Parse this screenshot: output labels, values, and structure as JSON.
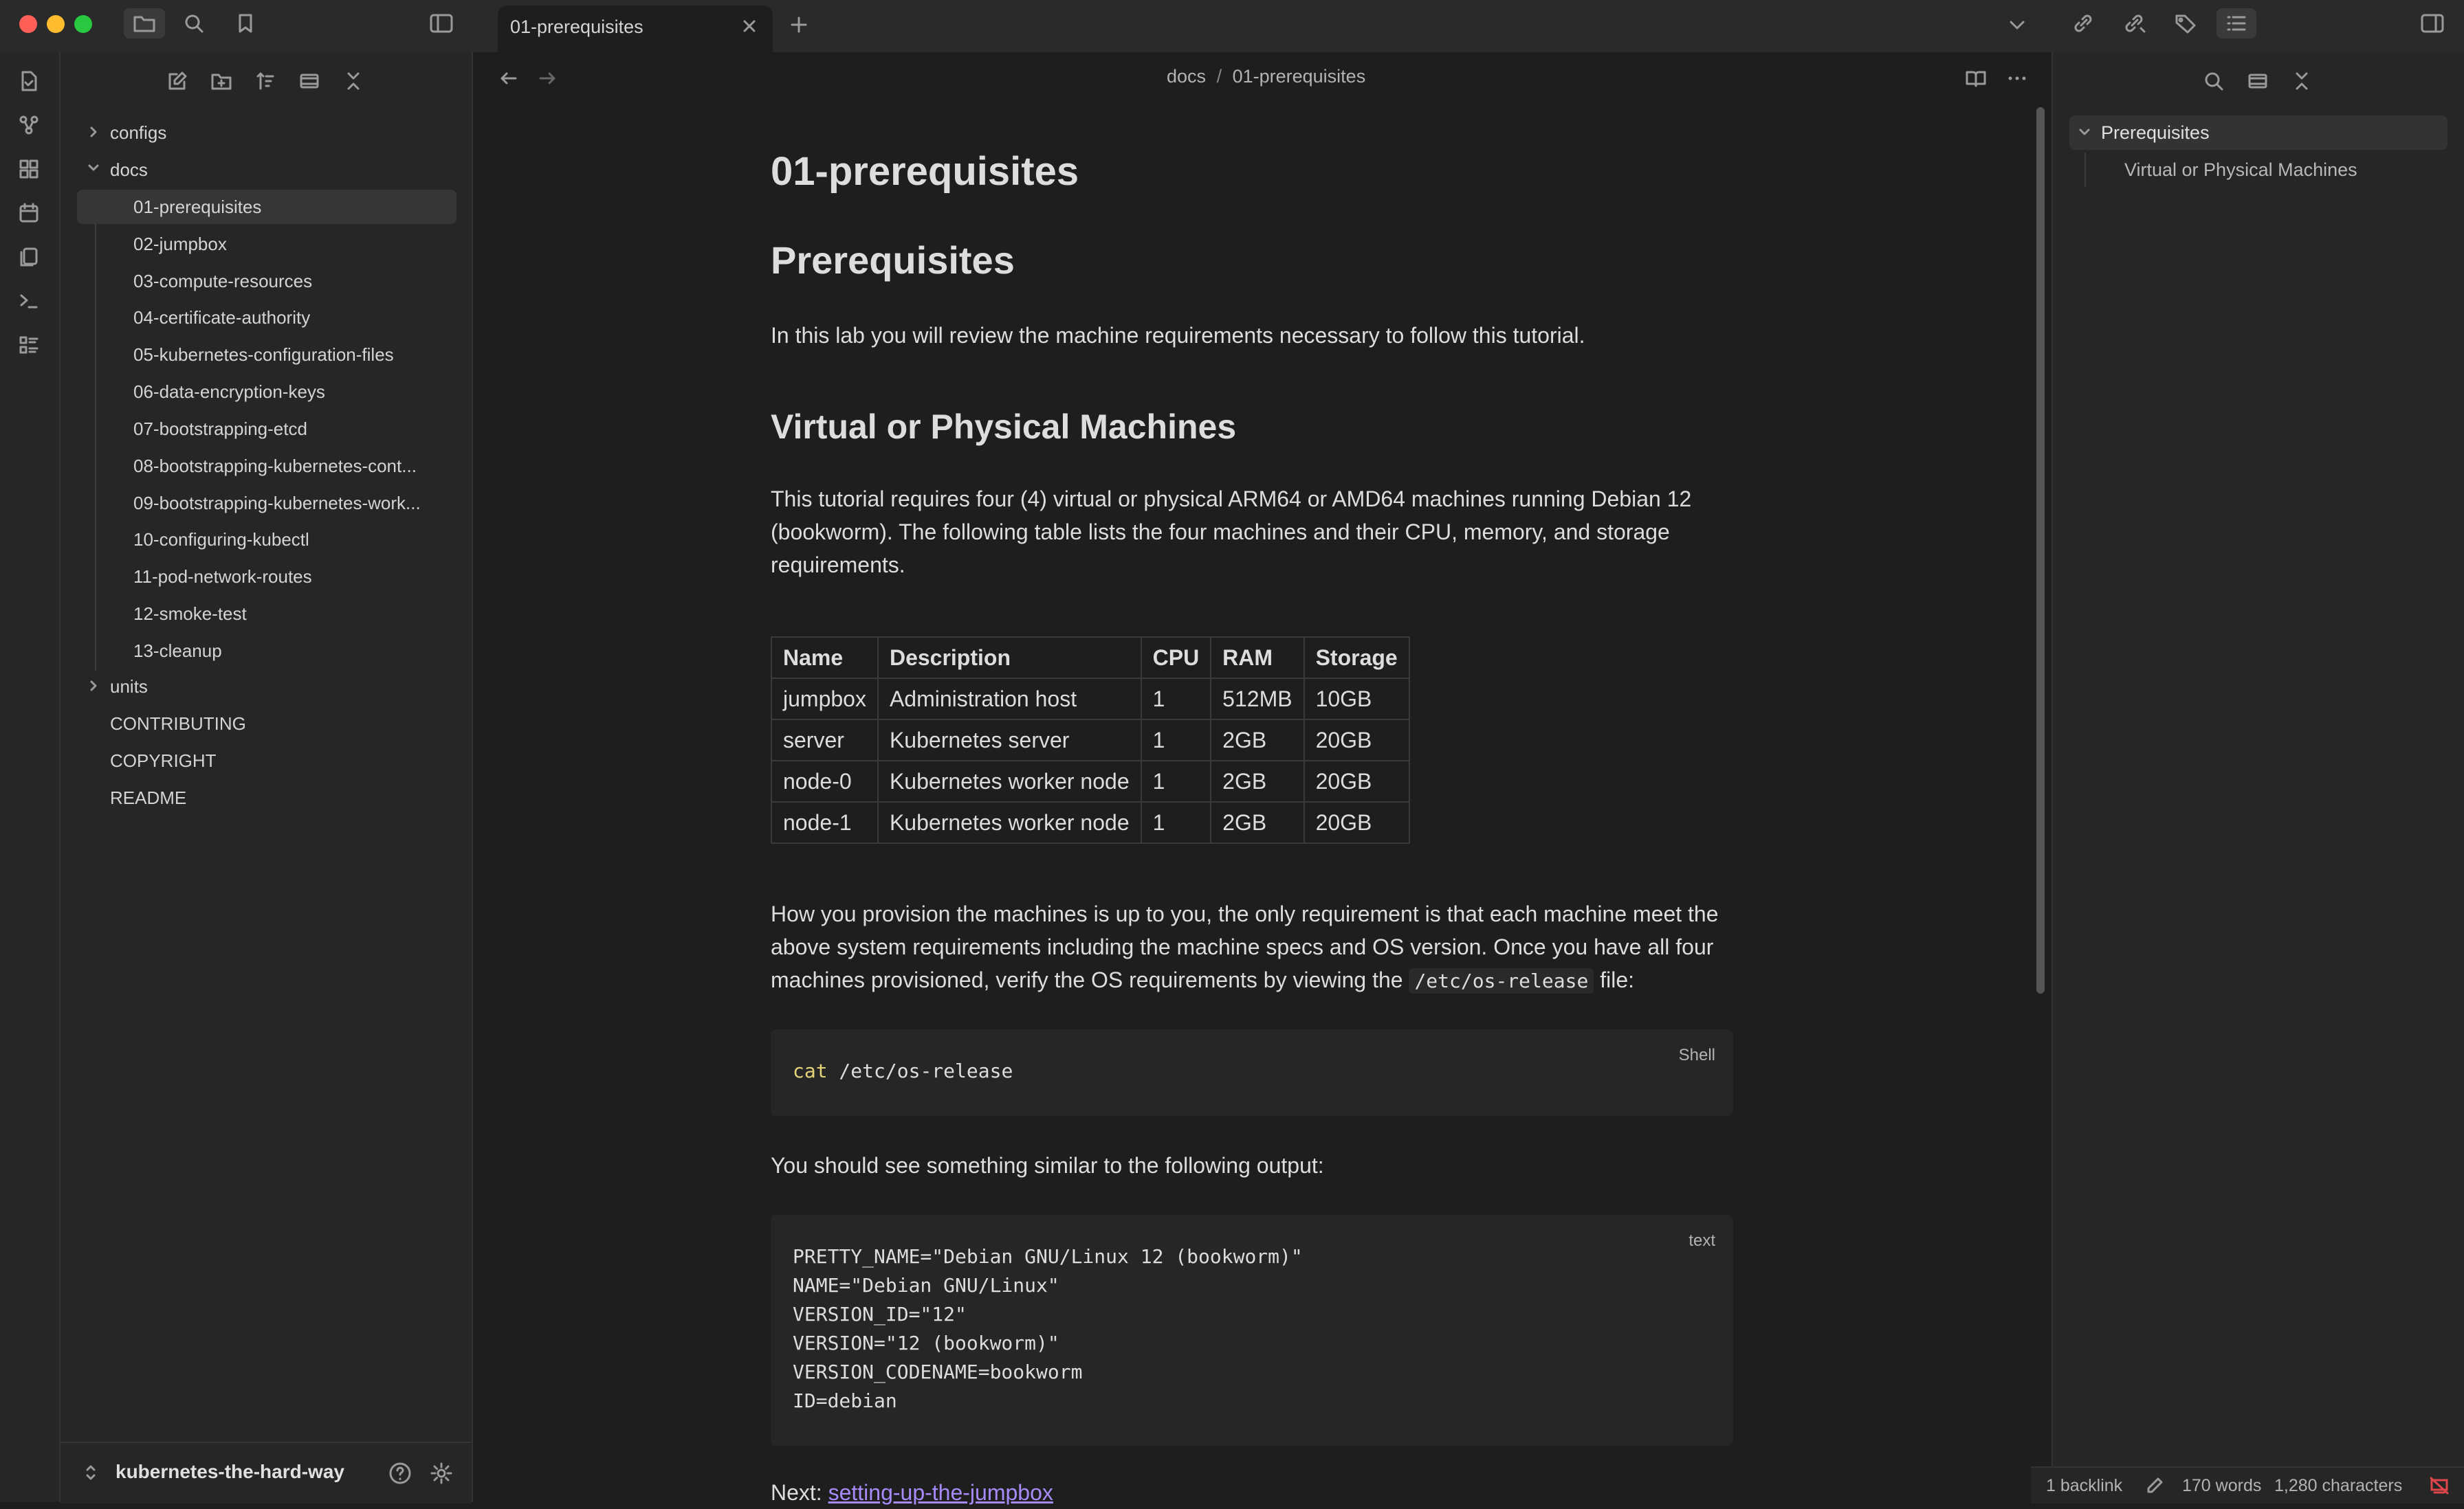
{
  "app": {
    "tab_title": "01-prerequisites",
    "vault_name": "kubernetes-the-hard-way"
  },
  "breadcrumb": {
    "parent": "docs",
    "separator": "/",
    "current": "01-prerequisites"
  },
  "explorer": {
    "root_folders_top": [
      {
        "label": "configs",
        "expanded": false
      },
      {
        "label": "docs",
        "expanded": true
      }
    ],
    "docs_items": [
      "01-prerequisites",
      "02-jumpbox",
      "03-compute-resources",
      "04-certificate-authority",
      "05-kubernetes-configuration-files",
      "06-data-encryption-keys",
      "07-bootstrapping-etcd",
      "08-bootstrapping-kubernetes-cont...",
      "09-bootstrapping-kubernetes-work...",
      "10-configuring-kubectl",
      "11-pod-network-routes",
      "12-smoke-test",
      "13-cleanup"
    ],
    "folder_units": "units",
    "root_files": [
      "CONTRIBUTING",
      "COPYRIGHT",
      "README"
    ]
  },
  "document": {
    "inline_title": "01-prerequisites",
    "h1": "Prerequisites",
    "intro": "In this lab you will review the machine requirements necessary to follow this tutorial.",
    "h2": "Virtual or Physical Machines",
    "para1": "This tutorial requires four (4) virtual or physical ARM64 or AMD64 machines running Debian 12 (bookworm). The following table lists the four machines and their CPU, memory, and storage requirements.",
    "table": {
      "headers": [
        "Name",
        "Description",
        "CPU",
        "RAM",
        "Storage"
      ],
      "rows": [
        [
          "jumpbox",
          "Administration host",
          "1",
          "512MB",
          "10GB"
        ],
        [
          "server",
          "Kubernetes server",
          "1",
          "2GB",
          "20GB"
        ],
        [
          "node-0",
          "Kubernetes worker node",
          "1",
          "2GB",
          "20GB"
        ],
        [
          "node-1",
          "Kubernetes worker node",
          "1",
          "2GB",
          "20GB"
        ]
      ]
    },
    "para2_before": "How you provision the machines is up to you, the only requirement is that each machine meet the above system requirements including the machine specs and OS version. Once you have all four machines provisioned, verify the OS requirements by viewing the",
    "para2_code": "/etc/os-release",
    "para2_after": "file:",
    "code1": {
      "lang": "Shell",
      "keyword": "cat",
      "rest": " /etc/os-release"
    },
    "para3": "You should see something similar to the following output:",
    "code2": {
      "lang": "text",
      "text": "PRETTY_NAME=\"Debian GNU/Linux 12 (bookworm)\"\nNAME=\"Debian GNU/Linux\"\nVERSION_ID=\"12\"\nVERSION=\"12 (bookworm)\"\nVERSION_CODENAME=bookworm\nID=debian"
    },
    "next_label": "Next:",
    "next_link": "setting-up-the-jumpbox"
  },
  "outline": {
    "heading": "Prerequisites",
    "children": [
      "Virtual or Physical Machines"
    ]
  },
  "status": {
    "backlinks": "1 backlink",
    "words": "170 words",
    "characters": "1,280 characters"
  },
  "colors": {
    "accent_link": "#a88bfa",
    "keyword": "#e5d378",
    "traffic_red": "#ff5f57",
    "traffic_yellow": "#febc2e",
    "traffic_green": "#28c840"
  }
}
